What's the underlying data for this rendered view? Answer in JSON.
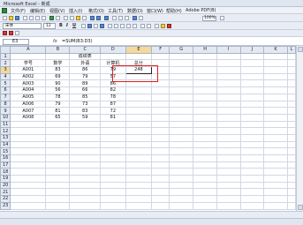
{
  "app": {
    "title": "Microsoft Excel - 新成"
  },
  "menu": [
    "文件(F)",
    "编辑(E)",
    "视图(V)",
    "插入(I)",
    "格式(O)",
    "工具(T)",
    "数据(D)",
    "窗口(W)",
    "帮助(H)",
    "Adobe PDF(B)"
  ],
  "format_toolbar": {
    "font": "宋体",
    "font_size": "12",
    "bold": "B",
    "italic": "I",
    "underline": "U",
    "zoom": "100%"
  },
  "formula_bar": {
    "name_box": "E3",
    "fx": "fx",
    "formula": "=SUM(B3:D3)"
  },
  "columns": [
    "A",
    "B",
    "C",
    "D",
    "E",
    "F",
    "G",
    "H",
    "I",
    "J",
    "K",
    "L"
  ],
  "sheet": {
    "title": "成绩表",
    "headers": [
      "学号",
      "数学",
      "外语",
      "计算机",
      "总分"
    ],
    "rows": [
      [
        "A001",
        "83",
        "86",
        "79",
        "248"
      ],
      [
        "A002",
        "69",
        "79",
        "57",
        ""
      ],
      [
        "A003",
        "90",
        "89",
        "86",
        ""
      ],
      [
        "A004",
        "56",
        "66",
        "82",
        ""
      ],
      [
        "A005",
        "78",
        "85",
        "78",
        ""
      ],
      [
        "A006",
        "79",
        "73",
        "87",
        ""
      ],
      [
        "A007",
        "81",
        "83",
        "72",
        ""
      ],
      [
        "A008",
        "65",
        "59",
        "81",
        ""
      ]
    ]
  },
  "colors": {
    "highlight": "#e02020",
    "header_bg": "#e3e9f3",
    "active_header": "#f5d89a"
  }
}
